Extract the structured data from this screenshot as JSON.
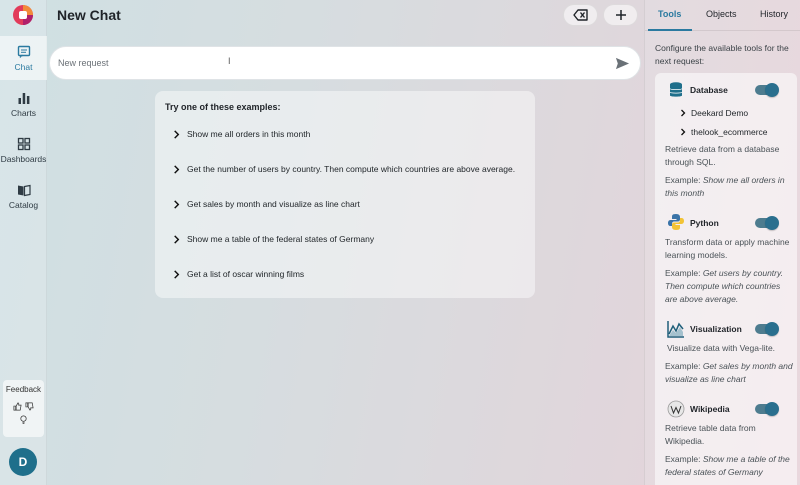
{
  "app": {
    "page_title": "New Chat",
    "avatar_initial": "D"
  },
  "sidebar": {
    "items": [
      {
        "label": "Chat",
        "icon": "chat-icon",
        "active": true
      },
      {
        "label": "Charts",
        "icon": "bar-chart-icon",
        "active": false
      },
      {
        "label": "Dashboards",
        "icon": "dashboard-icon",
        "active": false
      },
      {
        "label": "Catalog",
        "icon": "book-icon",
        "active": false
      }
    ],
    "feedback_label": "Feedback"
  },
  "request": {
    "placeholder": "New request"
  },
  "examples": {
    "title": "Try one of these examples:",
    "items": [
      "Show me all orders in this month",
      "Get the number of users by country. Then compute which countries are above average.",
      "Get sales by month and visualize as line chart",
      "Show me a table of the federal states of Germany",
      "Get a list of oscar winning films"
    ]
  },
  "right_panel": {
    "tabs": [
      "Tools",
      "Objects",
      "History"
    ],
    "active_tab": "Tools",
    "description": "Configure the available tools for the next request:",
    "tools": {
      "database": {
        "name": "Database",
        "enabled": true,
        "children": [
          "Deekard Demo",
          "thelook_ecommerce"
        ],
        "description": "Retrieve data from a database through SQL.",
        "example_prefix": "Example:",
        "example": "Show me all orders in this month"
      },
      "python": {
        "name": "Python",
        "enabled": true,
        "description": "Transform data or apply machine learning models.",
        "example_prefix": "Example:",
        "example": "Get users by country. Then compute which countries are above average."
      },
      "visualization": {
        "name": "Visualization",
        "enabled": true,
        "description": "Visualize data with Vega-lite.",
        "example_prefix": "Example:",
        "example": "Get sales by month and visualize as line chart"
      },
      "wikipedia": {
        "name": "Wikipedia",
        "enabled": true,
        "description": "Retrieve table data from Wikipedia.",
        "example_prefix": "Example:",
        "example": "Show me a table of the federal states of Germany"
      }
    }
  },
  "colors": {
    "accent": "#2a7aa0",
    "avatar": "#1f6f8b",
    "toggle_on": "#2a6f8e"
  }
}
